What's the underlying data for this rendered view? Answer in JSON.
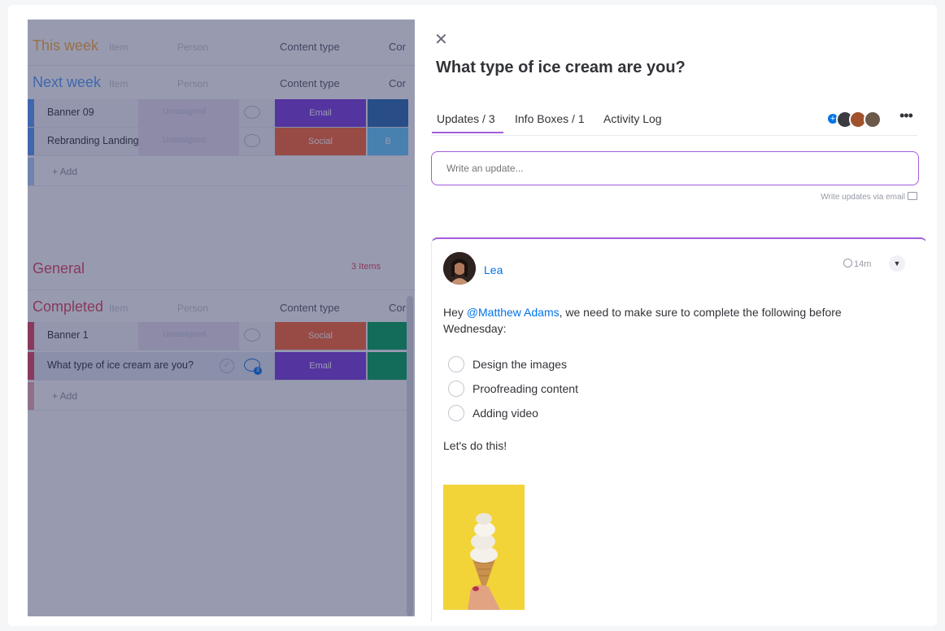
{
  "board": {
    "groups": [
      {
        "title": "This week",
        "color": "#fdab3d",
        "ghost1": "Item",
        "ghost2": "Person",
        "col_content_type": "Content type",
        "col_next": "Cor"
      },
      {
        "title": "Next week",
        "color": "#579bfc",
        "ghost1": "Item",
        "ghost2": "Person",
        "col_content_type": "Content type",
        "col_next": "Cor"
      },
      {
        "title": "General",
        "color": "#e2445c",
        "items_count": "3 Items"
      },
      {
        "title": "Completed",
        "color": "#e2445c",
        "ghost1": "Item",
        "ghost2": "Person",
        "col_content_type": "Content type",
        "col_next": "Cor"
      }
    ],
    "next_week_rows": [
      {
        "name": "Banner 09",
        "person": "Unassigned",
        "tag": "Email",
        "tag_color": "#7e3bde",
        "tag2": "",
        "tag2_color": "#2b6cb0"
      },
      {
        "name": "Rebranding Landing Page",
        "person": "Unassigned",
        "tag": "Social",
        "tag_color": "#ff6433",
        "tag2": "B",
        "tag2_color": "#66ccff"
      }
    ],
    "completed_rows": [
      {
        "name": "Banner 1",
        "person": "Unassigned",
        "tag": "Social",
        "tag_color": "#ff6433",
        "tag2": "",
        "tag2_color": "#00a359"
      },
      {
        "name": "What type of ice cream are you?",
        "tag": "Email",
        "tag_color": "#7e3bde",
        "tag2": "",
        "tag2_color": "#00a359",
        "badge": "3"
      }
    ],
    "add_label": "+ Add"
  },
  "panel": {
    "title": "What type of ice cream are you?",
    "tabs": [
      "Updates / 3",
      "Info Boxes / 1",
      "Activity Log"
    ],
    "more": "•••",
    "update_placeholder": "Write an update...",
    "write_via_email": "Write updates via email",
    "post": {
      "author": "Lea",
      "time": "14m",
      "mention": "@Matthew Adams",
      "message_prefix": "Hey ",
      "message_suffix": ", we need to make sure to complete the following before Wednesday:",
      "checklist": [
        "Design the images",
        "Proofreading content",
        "Adding video"
      ],
      "closing": "Let's do this!"
    }
  },
  "colors": {
    "accent": "#a25ddc",
    "link": "#0073ea"
  }
}
